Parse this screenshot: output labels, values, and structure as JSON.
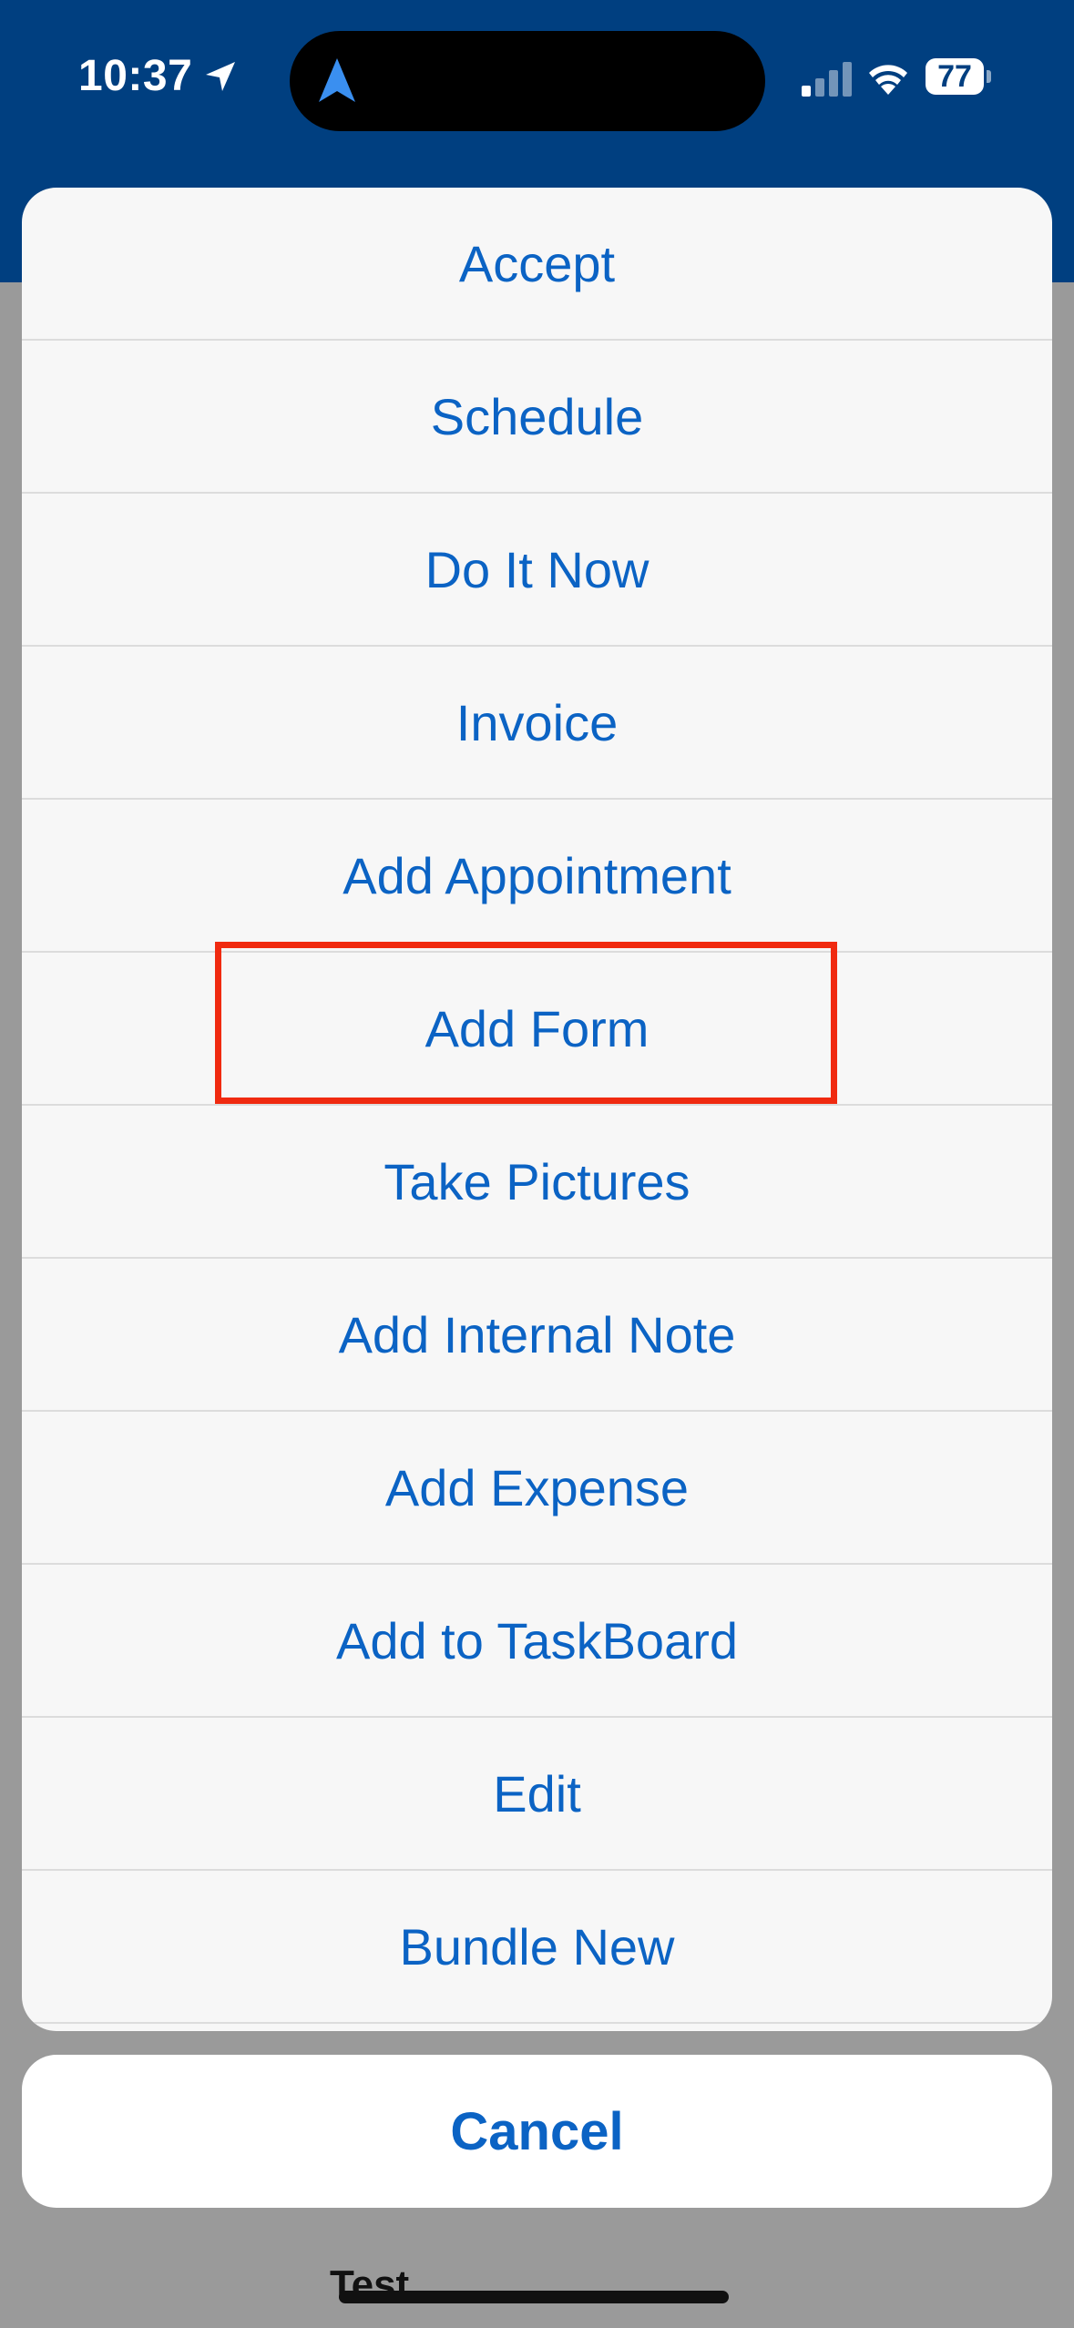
{
  "status_bar": {
    "time": "10:37",
    "battery": "77",
    "icons": [
      "location-arrow-icon",
      "navigation-icon",
      "cellular-signal-icon",
      "wifi-icon",
      "battery-icon"
    ]
  },
  "backdrop": {
    "partial_label": "Test"
  },
  "action_sheet": {
    "actions": [
      {
        "label": "Accept"
      },
      {
        "label": "Schedule"
      },
      {
        "label": "Do It Now"
      },
      {
        "label": "Invoice"
      },
      {
        "label": "Add Appointment"
      },
      {
        "label": "Add Form"
      },
      {
        "label": "Take Pictures"
      },
      {
        "label": "Add Internal Note"
      },
      {
        "label": "Add Expense"
      },
      {
        "label": "Add to TaskBoard"
      },
      {
        "label": "Edit"
      },
      {
        "label": "Bundle New"
      }
    ],
    "cancel_label": "Cancel",
    "highlighted_action": "Add Form"
  },
  "colors": {
    "header": "#003f80",
    "action_text": "#0b63c4",
    "highlight_border": "#f02a10",
    "dim_backdrop": "#9a9a9a"
  }
}
